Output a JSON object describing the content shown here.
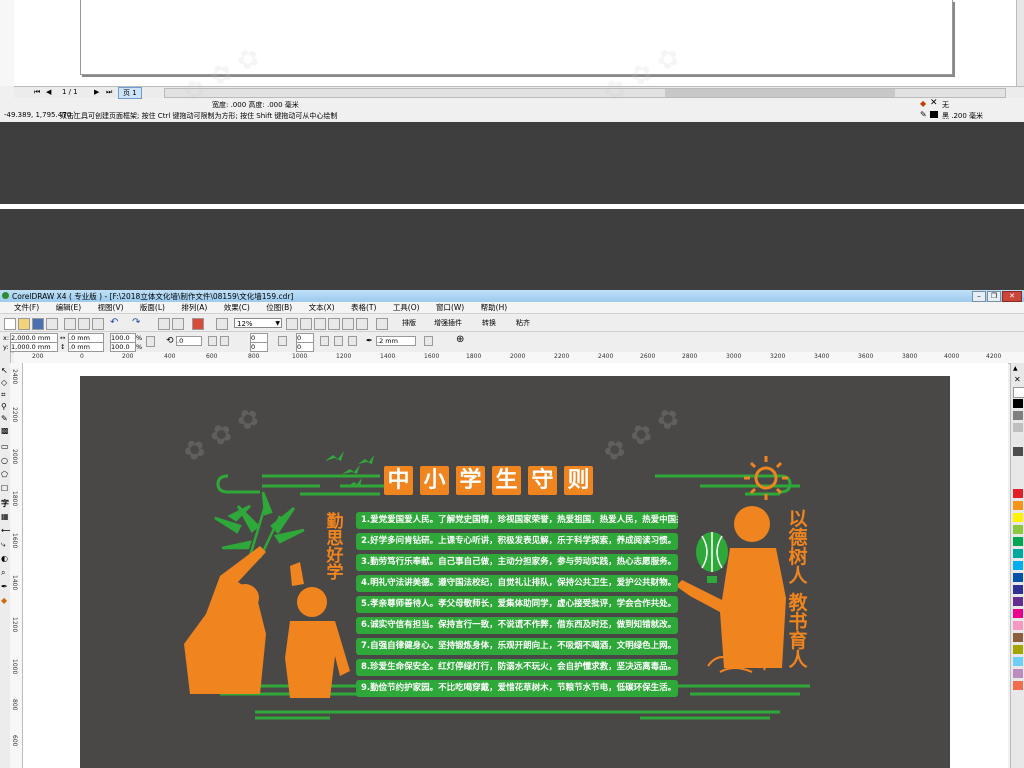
{
  "top_window": {
    "page_nav": "1 / 1",
    "page_tab": "页 1",
    "dims_text": "宽度: .000  高度: .000  毫米",
    "status_coords": "-49.389, 1,795.470 )",
    "status_hint": "双击工具可创建页面框架; 按住 Ctrl 键拖动可限制为方形; 按住 Shift 键拖动可从中心绘制",
    "fill_label": "无",
    "outline_label": "黑  .200 毫米"
  },
  "app": {
    "title": "CorelDRAW X4 ( 专业版 ) - [F:\\2018立体文化墙\\制作文件\\08159\\文化墙159.cdr]",
    "menu": [
      "文件(F)",
      "编辑(E)",
      "视图(V)",
      "版面(L)",
      "排列(A)",
      "效果(C)",
      "位图(B)",
      "文本(X)",
      "表格(T)",
      "工具(O)",
      "窗口(W)",
      "帮助(H)"
    ],
    "zoom": "12%",
    "toolbar_extra": [
      "排版",
      "增强插件",
      "转换",
      "粘齐"
    ],
    "x_field": "2,000.0 mm",
    "y_field": "1,000.0 mm",
    "w_field": ".0 mm",
    "h_field": ".0 mm",
    "scale_w": "100.0",
    "scale_h": "100.0",
    "scale_unit": "%",
    "angle": ".0",
    "stroke": ".2 mm",
    "num_a": "0",
    "num_b": "0",
    "ruler_ticks": [
      "200",
      "0",
      "200",
      "400",
      "600",
      "800",
      "1000",
      "1200",
      "1400",
      "1600",
      "1800",
      "2000",
      "2200",
      "2400",
      "2600",
      "2800",
      "3000",
      "3200",
      "3400",
      "3600",
      "3800",
      "4000",
      "4200"
    ],
    "vruler_ticks": [
      "2400",
      "2200",
      "2000",
      "1800",
      "1600",
      "1400",
      "1200",
      "1000",
      "800",
      "600",
      "400"
    ]
  },
  "design": {
    "title_chars": [
      "中",
      "小",
      "学",
      "生",
      "守",
      "则"
    ],
    "left_slogan": "勤思好学",
    "right_slogan_1": "以德树人",
    "right_slogan_2": "教书育人",
    "rules": [
      "1.爱党爱国爱人民。了解党史国情，珍视国家荣誉，热爱祖国，热爱人民，热爱中国共产党。",
      "2.好学多问肯钻研。上课专心听讲，积极发表见解，乐于科学探索，养成阅读习惯。",
      "3.勤劳笃行乐奉献。自己事自己做，主动分担家务，参与劳动实践，热心志愿服务。",
      "4.明礼守法讲美德。遵守国法校纪，自觉礼让排队，保持公共卫生，爱护公共财物。",
      "5.孝亲尊师善待人。孝父母敬师长，爱集体助同学，虚心接受批评，学会合作共处。",
      "6.诚实守信有担当。保持言行一致，不说谎不作弊，借东西及时还，做到知错就改。",
      "7.自强自律健身心。坚持锻炼身体，乐观开朗向上，不吸烟不喝酒，文明绿色上网。",
      "8.珍爱生命保安全。红灯停绿灯行，防溺水不玩火，会自护懂求救，坚决远离毒品。",
      "9.勤俭节约护家园。不比吃喝穿戴，爱惜花草树木，节粮节水节电，低碳环保生活。"
    ],
    "colors": {
      "orange": "#f0841e",
      "green": "#2fa83a",
      "board": "#4a4847"
    }
  }
}
